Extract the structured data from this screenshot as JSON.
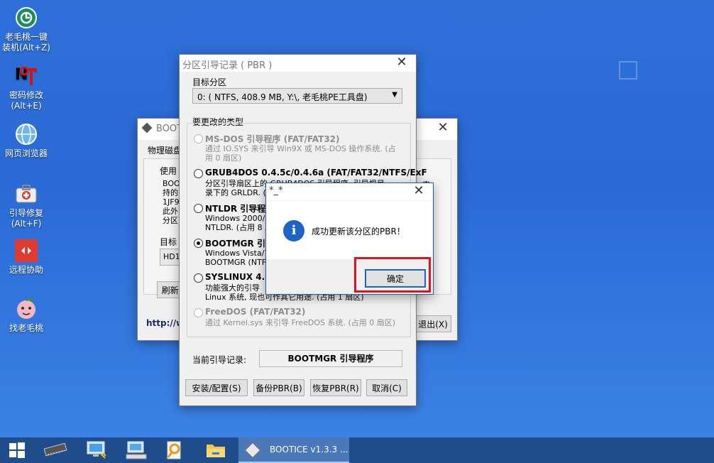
{
  "desktop": {
    "icons": [
      {
        "label": "老毛桃一键\n装机(Alt+Z)",
        "icon": "installer-icon"
      },
      {
        "label": "密码修改\n(Alt+E)",
        "icon": "password-key-icon"
      },
      {
        "label": "网页浏览器",
        "icon": "globe-icon"
      },
      {
        "label": "引导修复\n(Alt+F)",
        "icon": "repair-kit-icon"
      },
      {
        "label": "远程协助",
        "icon": "remote-assist-icon"
      },
      {
        "label": "找老毛桃",
        "icon": "peach-icon"
      }
    ]
  },
  "bootice_main": {
    "title": "BOOTI",
    "tab_label": "物理磁盘",
    "group_label": "使用",
    "text_lines": [
      "BOOT",
      "持的",
      "1JF9,",
      "此外",
      "分区"
    ],
    "target_label": "目标",
    "disk_value": "HD1:",
    "refresh_label": "刷新(",
    "link_text": "http://w",
    "right_trunc": "索",
    "exit_label": "退出(X)"
  },
  "pbr_dialog": {
    "title": "分区引导记录 ( PBR )",
    "target_partition_label": "目标分区",
    "target_partition_value": "0: ( NTFS, 408.9 MB, Y:\\, 老毛桃PE工具盘)",
    "change_type_label": "要更改的类型",
    "options": [
      {
        "title": "MS-DOS 引导程序 (FAT/FAT32)",
        "desc": [
          "通过 IO.SYS 来引导 Win9X 或 MS-DOS 操作系统. (占",
          "用 0 扇区)"
        ],
        "enabled": false,
        "checked": false
      },
      {
        "title": "GRUB4DOS 0.4.5c/0.4.6a (FAT/FAT32/NTFS/ExF",
        "desc": [
          "分区引导扇区上的 GRUB4DOS 引导程序. 引导根目",
          "录下的 GRLDR. (占"
        ],
        "enabled": true,
        "checked": false
      },
      {
        "title": "NTLDR 引导程序",
        "desc": [
          "Windows 2000/XP",
          "NTLDR. (占用 8 扇"
        ],
        "enabled": true,
        "checked": false
      },
      {
        "title": "BOOTMGR 引导",
        "desc": [
          "Windows Vista/7/",
          "BOOTMGR (NTFS"
        ],
        "enabled": true,
        "checked": true
      },
      {
        "title": "SYSLINUX 4.07",
        "desc": [
          "功能强大的引导",
          "Linux 系统, 现也可作其它用途. (占用 1 扇区)"
        ],
        "enabled": true,
        "checked": false
      },
      {
        "title": "FreeDOS (FAT/FAT32)",
        "desc": [
          "通过 Kernel.sys 来引导 FreeDOS 系统. (占用 0 扇区)"
        ],
        "enabled": false,
        "checked": false
      }
    ],
    "current_record_label": "当前引导记录:",
    "current_record_value": "BOOTMGR 引导程序",
    "buttons": {
      "install": "安装/配置(S)",
      "backup": "备份PBR(B)",
      "restore": "恢复PBR(R)",
      "cancel": "取消(C)"
    }
  },
  "message_box": {
    "title": "*_*",
    "message": "成功更新该分区的PBR！",
    "ok_label": "确定",
    "highlight_color": "#e0141e"
  },
  "taskbar": {
    "items": [
      "start-windows-icon",
      "memory-chip-icon",
      "network-computer-icon",
      "keyboard-computer-icon",
      "search-tool-icon",
      "folder-icon"
    ],
    "active_app_label": "BOOTICE v1.3.3 ..."
  }
}
